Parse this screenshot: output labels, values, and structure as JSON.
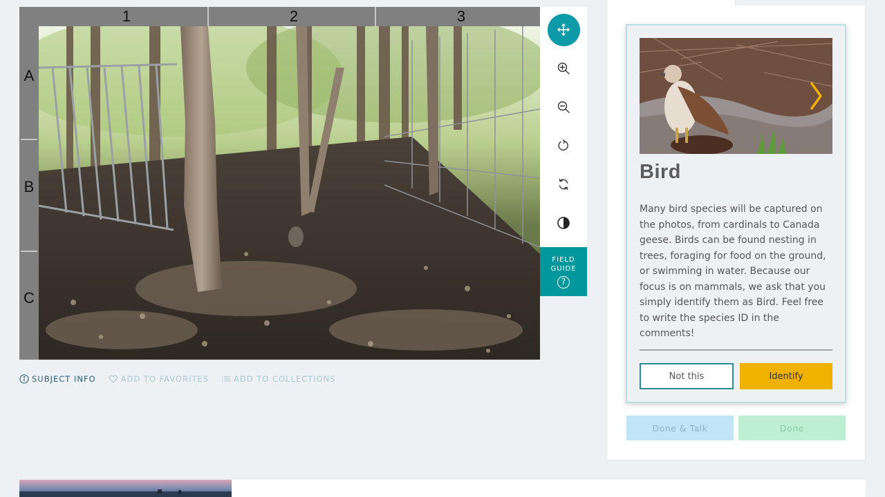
{
  "viewer": {
    "columns": [
      "1",
      "2",
      "3"
    ],
    "rows": [
      "A",
      "B",
      "C"
    ]
  },
  "toolbar": {
    "tools": [
      {
        "name": "move",
        "icon": "move-icon",
        "active": true
      },
      {
        "name": "zoom-in",
        "icon": "zoom-in-icon"
      },
      {
        "name": "zoom-out",
        "icon": "zoom-out-icon"
      },
      {
        "name": "rotate",
        "icon": "rotate-icon"
      },
      {
        "name": "reset",
        "icon": "reset-icon"
      },
      {
        "name": "invert",
        "icon": "contrast-icon"
      }
    ],
    "field_guide_line1": "FIELD",
    "field_guide_line2": "GUIDE",
    "field_guide_icon": "?",
    "accent": "#00979d"
  },
  "meta": {
    "subject_info": "SUBJECT INFO",
    "add_to_favorites": "ADD TO FAVORITES",
    "add_to_collections": "ADD TO COLLECTIONS"
  },
  "card": {
    "title": "Bird",
    "description": "Many bird species will be captured on the photos, from cardinals to Canada geese. Birds can be found nesting in trees, foraging for food on the ground, or swimming in water. Because our focus is on mammals, we ask that you simply identify them as Bird. Feel free to write the species ID in the comments!",
    "not_this": "Not this",
    "identify": "Identify",
    "identify_color": "#f0b100"
  },
  "actions": {
    "done_talk": "Done & Talk",
    "done": "Done"
  }
}
